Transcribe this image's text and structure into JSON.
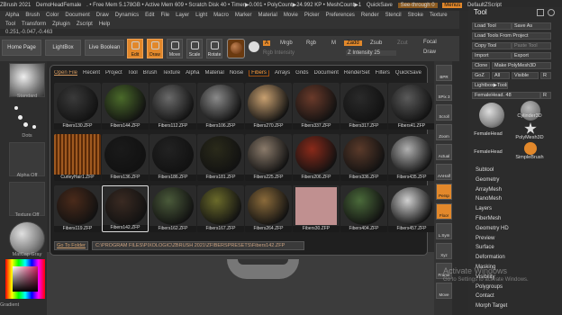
{
  "titlebar": {
    "items": [
      "ZBrush 2021",
      "DemoHeadFemale",
      ". • Free Mem 5.178GB • Active Mem 609 • Scratch Disk 40 • Timer▶0.001 • PolyCount▶24.992 KP • MeshCount▶1",
      "QuickSave"
    ],
    "seethrough": "See-through 0",
    "menus_btn": "Menus",
    "default_script": "DefaultZScript"
  },
  "menubar": {
    "row1": [
      "Alpha",
      "Brush",
      "Color",
      "Document",
      "Draw",
      "Dynamics",
      "Edit",
      "File",
      "Layer",
      "Light",
      "Macro",
      "Marker",
      "Material",
      "Movie",
      "Picker",
      "Preferences",
      "Render",
      "Stencil",
      "Stroke",
      "Texture"
    ],
    "row2": [
      "Tool",
      "Transform",
      "Zplugin",
      "Zscript",
      "Help"
    ]
  },
  "coords": "0.251,-0.047,-0.463",
  "topshelf": {
    "home": "Home Page",
    "lightbox": "LightBox",
    "liveboolean": "Live Boolean",
    "edit": "Edit",
    "draw": "Draw",
    "move": "Move",
    "scale": "Scale",
    "rotate": "Rotate",
    "a": "A",
    "mrgb": "Mrgb",
    "rgb": "Rgb",
    "m": "M",
    "zadd": "Zadd",
    "zsub": "Zsub",
    "zcut": "Zcut",
    "rgb_intensity": "Rgb Intensity",
    "z_intensity": "Z Intensity 25",
    "focal": "Focal",
    "draw_size": "Draw"
  },
  "leftpanel": {
    "standard": "Standard",
    "dots": "Dots",
    "alpha_off": "Alpha Off",
    "texture_off": "Texture Off",
    "matcap": "MatCap Gray",
    "gradient": "Gradient"
  },
  "lightbox": {
    "tabs": [
      "Open File",
      "Recent",
      "Project",
      "Tool",
      "Brush",
      "Texture",
      "Alpha",
      "Material",
      "Noise",
      "Fibers",
      "Arrays",
      "Grids",
      "Document",
      "RenderSet",
      "Filters",
      "QuickSave",
      "Spotlight"
    ],
    "active_tab": "Fibers",
    "tiles": [
      [
        "Fibers130.ZFP",
        "Fibers144.ZFP",
        "Fibers112.ZFP",
        "Fibers106.ZFP",
        "Fibers270.ZFP",
        "Fibers337.ZFP",
        "Fibers317.ZFP",
        "Fibers41.ZFP"
      ],
      [
        "CurleyHair1.ZFP",
        "Fibers136.ZFP",
        "Fibers186.ZFP",
        "Fibers181.ZFP",
        "Fibers225.ZFP",
        "Fibers206.ZFP",
        "Fibers336.ZFP",
        "Fibers435.ZFP"
      ],
      [
        "Fibers119.ZFP",
        "Fibers142.ZFP",
        "Fibers162.ZFP",
        "Fibers167.ZFP",
        "Fibers264.ZFP",
        "Fibers30.ZFP",
        "Fibers404.ZFP",
        "Fibers457.ZFP"
      ]
    ],
    "goto": "Go To Folder",
    "path": "C:\\PROGRAM FILES\\PIXOLOGIC\\ZBRUSH 2021\\ZFIBERSPRESETS\\Fibers142.ZFP"
  },
  "rightstrip": [
    "BPR",
    "SPix 3",
    "Scroll",
    "Zoom",
    "Actual",
    "AAHalf",
    "Persp",
    "Floor",
    "L.Sym",
    "Xyz",
    "Frame",
    "Move"
  ],
  "toolpanel": {
    "title": "Tool",
    "load_tool": "Load Tool",
    "save_as": "Save As",
    "load_project": "Load Tools From Project",
    "copy_tool": "Copy Tool",
    "paste_tool": "Paste Tool",
    "import": "Import",
    "export": "Export",
    "clone": "Clone",
    "make_polymesh": "Make PolyMesh3D",
    "goz": "GoZ",
    "all": "All",
    "visible": "Visible",
    "r": "R",
    "lightbox_tools": "Lightbox▶Tools",
    "femalehead_slider": "FemaleHead. 48",
    "r2": "R",
    "thumbs": [
      "FemaleHead",
      "Cylinder3D",
      "PolyMesh3D",
      "FemaleHead",
      "SimpleBrush"
    ],
    "menu": [
      "Subtool",
      "Geometry",
      "ArrayMesh",
      "NanoMesh",
      "Layers",
      "FiberMesh",
      "Geometry HD",
      "Preview",
      "Surface",
      "Deformation",
      "Masking",
      "Visibility",
      "Polygroups",
      "Contact",
      "Morph Target"
    ]
  },
  "watermark": {
    "line1": "Activate Windows",
    "line2": "Go to Settings to activate Windows."
  },
  "colors": {
    "accent": "#e2882b",
    "panel": "#2c2c2c",
    "bg": "#1f1f1f"
  }
}
